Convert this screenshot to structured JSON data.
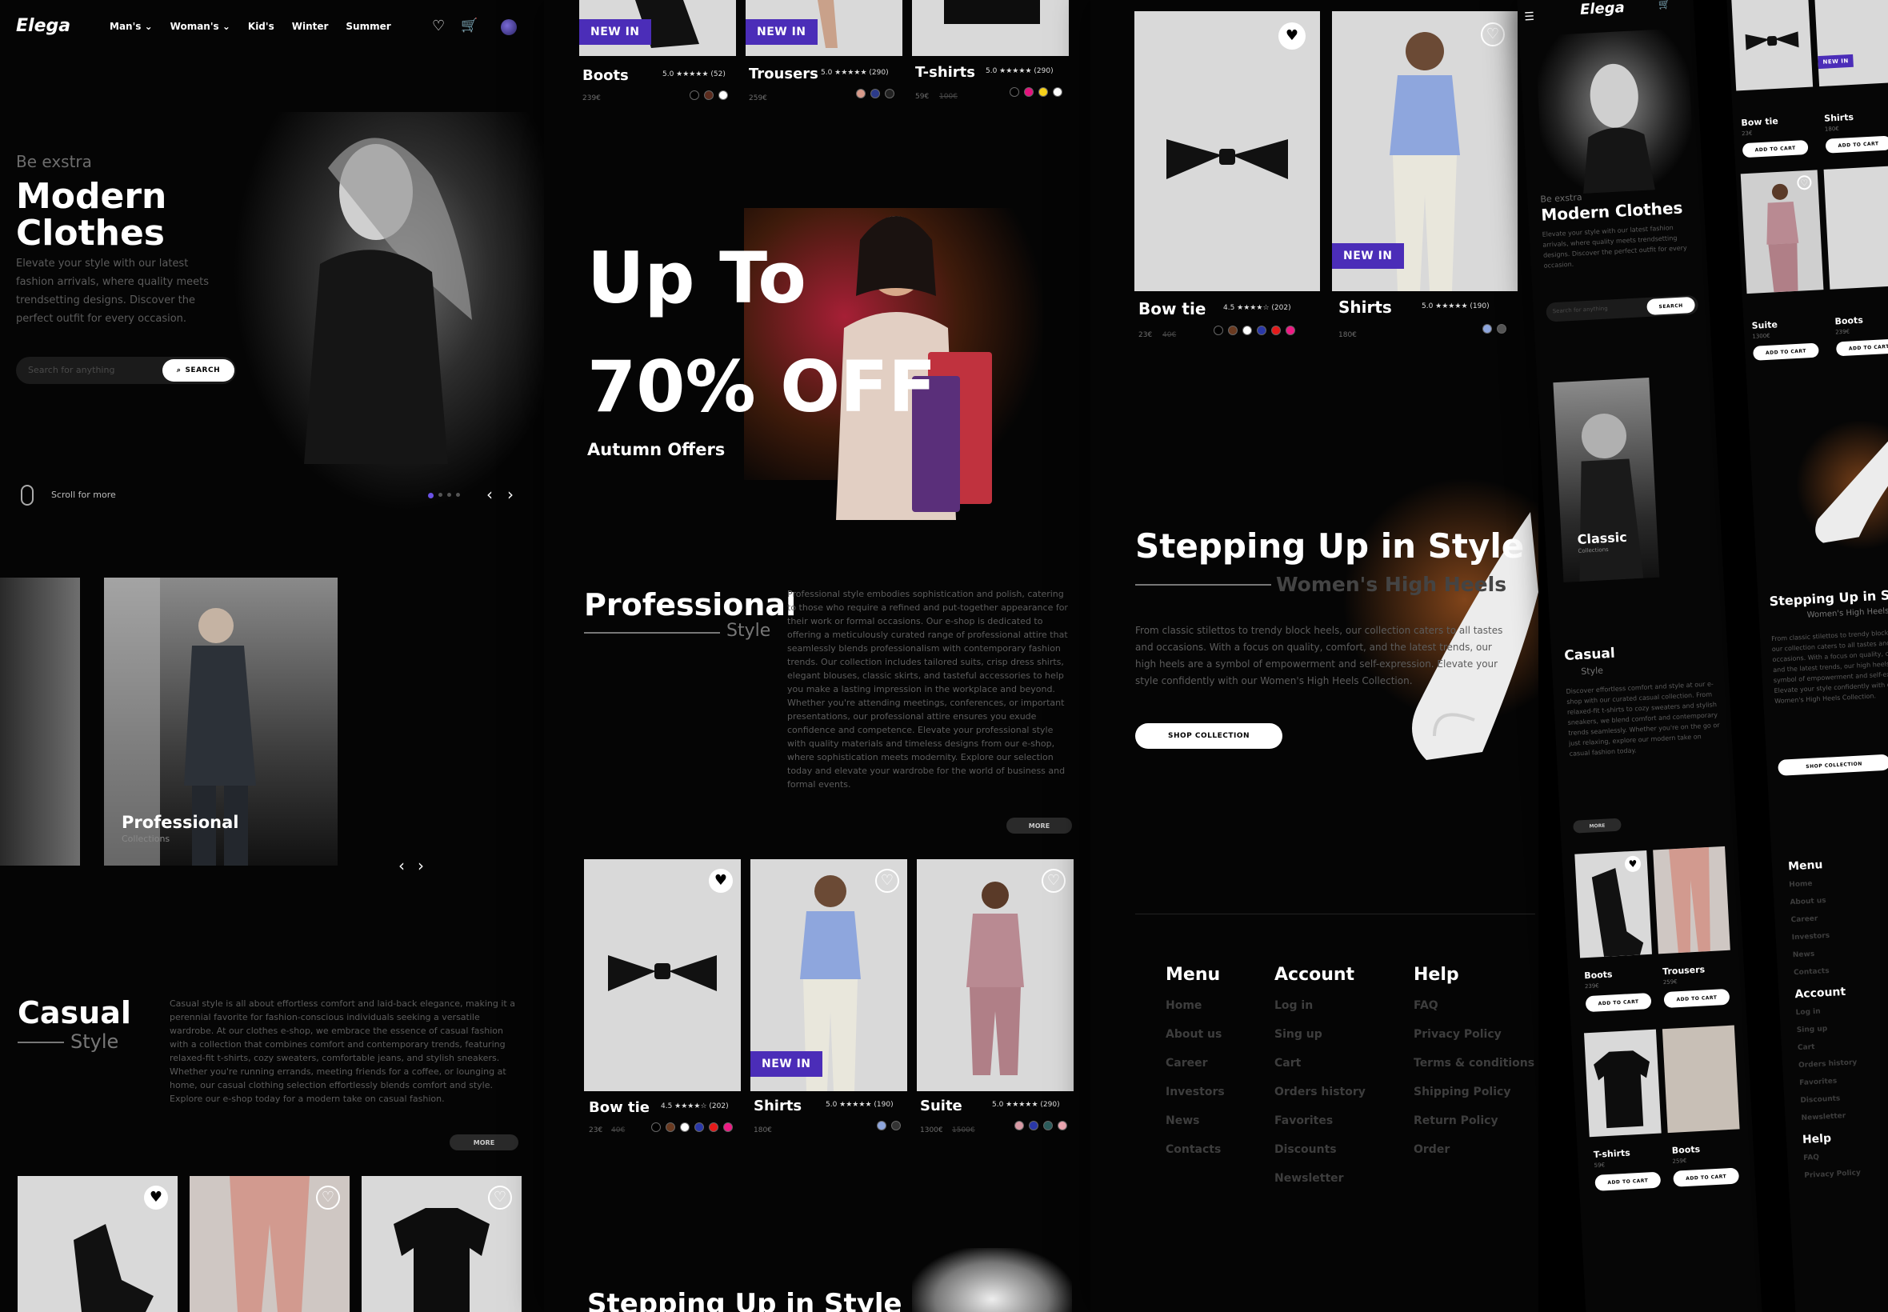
{
  "brand": "Elega",
  "nav": [
    "Man's",
    "Woman's",
    "Kid's",
    "Winter",
    "Summer"
  ],
  "hero": {
    "eyebrow": "Be exstra",
    "title_line1": "Modern",
    "title_line2": "Clothes",
    "description": "Elevate your style with our latest fashion arrivals, where quality meets trendsetting designs. Discover the perfect outfit for every occasion.",
    "search_placeholder": "Search for anything",
    "search_button": "SEARCH",
    "scroll_text": "Scroll for more"
  },
  "collections": {
    "professional_label": "Professional",
    "professional_sub": "Collections",
    "classic_label": "Classic",
    "classic_sub": "Collections"
  },
  "casual": {
    "title": "Casual",
    "subtitle": "Style",
    "description": "Casual style is all about effortless comfort and laid-back elegance, making it a perennial favorite for fashion-conscious individuals seeking a versatile wardrobe. At our clothes e-shop, we embrace the essence of casual fashion with a collection that combines comfort and contemporary trends, featuring relaxed-fit t-shirts, cozy sweaters, comfortable jeans, and stylish sneakers. Whether you're running errands, meeting friends for a coffee, or lounging at home, our casual clothing selection effortlessly blends comfort and style. Explore our e-shop today for a modern take on casual fashion.",
    "more": "MORE"
  },
  "top_products": [
    {
      "name": "Boots",
      "rating": "5.0 ★★★★★ (52)",
      "price": "239€",
      "badge": "NEW IN"
    },
    {
      "name": "Trousers",
      "rating": "5.0 ★★★★★ (290)",
      "price": "259€",
      "badge": "NEW IN"
    },
    {
      "name": "T-shirts",
      "rating": "5.0 ★★★★★ (290)",
      "price": "59€",
      "old_price": "100€"
    }
  ],
  "promo": {
    "line1": "Up To",
    "line2": "70% OFF",
    "caption": "Autumn Offers"
  },
  "professional": {
    "title": "Professional",
    "subtitle": "Style",
    "description": "Professional style embodies sophistication and polish, catering to those who require a refined and put-together appearance for their work or formal occasions. Our e-shop is dedicated to offering a meticulously curated range of professional attire that seamlessly blends professionalism with contemporary fashion trends. Our collection includes tailored suits, crisp dress shirts, elegant blouses, classic skirts, and tasteful accessories to help you make a lasting impression in the workplace and beyond. Whether you're attending meetings, conferences, or important presentations, our professional attire ensures you exude confidence and competence. Elevate your professional style with quality materials and timeless designs from our e-shop, where sophistication meets modernity. Explore our selection today and elevate your wardrobe for the world of business and formal events.",
    "more": "MORE"
  },
  "mid_products": [
    {
      "name": "Bow tie",
      "rating": "4.5 ★★★★☆ (202)",
      "price": "23€",
      "old_price": "40€"
    },
    {
      "name": "Shirts",
      "rating": "5.0 ★★★★★ (190)",
      "price": "180€",
      "badge": "NEW IN"
    },
    {
      "name": "Suite",
      "rating": "5.0 ★★★★★ (290)",
      "price": "1300€",
      "old_price": "1500€"
    }
  ],
  "stepping": {
    "title": "Stepping Up in Style",
    "subtitle": "Women's High Heels",
    "description": "From classic stilettos to trendy block heels, our collection caters to all tastes and occasions. With a focus on quality, comfort, and the latest trends, our high heels are a symbol of empowerment and self-expression. Elevate your style confidently with our Women's High Heels Collection.",
    "button": "SHOP COLLECTION",
    "partial_title": "Stepping Up in Style"
  },
  "footer": {
    "menu_title": "Menu",
    "menu": [
      "Home",
      "About us",
      "Career",
      "Investors",
      "News",
      "Contacts"
    ],
    "account_title": "Account",
    "account": [
      "Log in",
      "Sing up",
      "Cart",
      "Orders history",
      "Favorites",
      "Discounts",
      "Newsletter"
    ],
    "help_title": "Help",
    "help": [
      "FAQ",
      "Privacy Policy",
      "Terms & conditions",
      "Shipping Policy",
      "Return Policy",
      "Order"
    ]
  },
  "mobile": {
    "cart_label": "ADD TO CART",
    "casual_title": "Casual",
    "casual_sub": "Style",
    "casual_text": "Discover effortless comfort and style at our e-shop with our curated casual collection. From relaxed-fit t-shirts to cozy sweaters and stylish sneakers, we blend comfort and contemporary trends seamlessly. Whether you're on the go or just relaxing, explore our modern take on casual fashion today.",
    "products_a": [
      {
        "name": "Boots",
        "price": "239€"
      },
      {
        "name": "Trousers",
        "price": "259€"
      },
      {
        "name": "T-shirts",
        "price": "59€"
      },
      {
        "name": "Boots",
        "price": "259€"
      }
    ],
    "products_b": [
      {
        "name": "Bow tie",
        "price": "23€"
      },
      {
        "name": "Shirts",
        "price": "180€"
      },
      {
        "name": "Suite",
        "price": "1300€"
      },
      {
        "name": "Boots",
        "price": "239€"
      }
    ],
    "stepping_sub": "Women's High Heels",
    "stepping_text": "From classic stilettos to trendy block heels, our collection caters to all tastes and occasions. With a focus on quality, comfort, and the latest trends, our high heels are a symbol of empowerment and self-expression. Elevate your style confidently with our Women's High Heels Collection."
  }
}
